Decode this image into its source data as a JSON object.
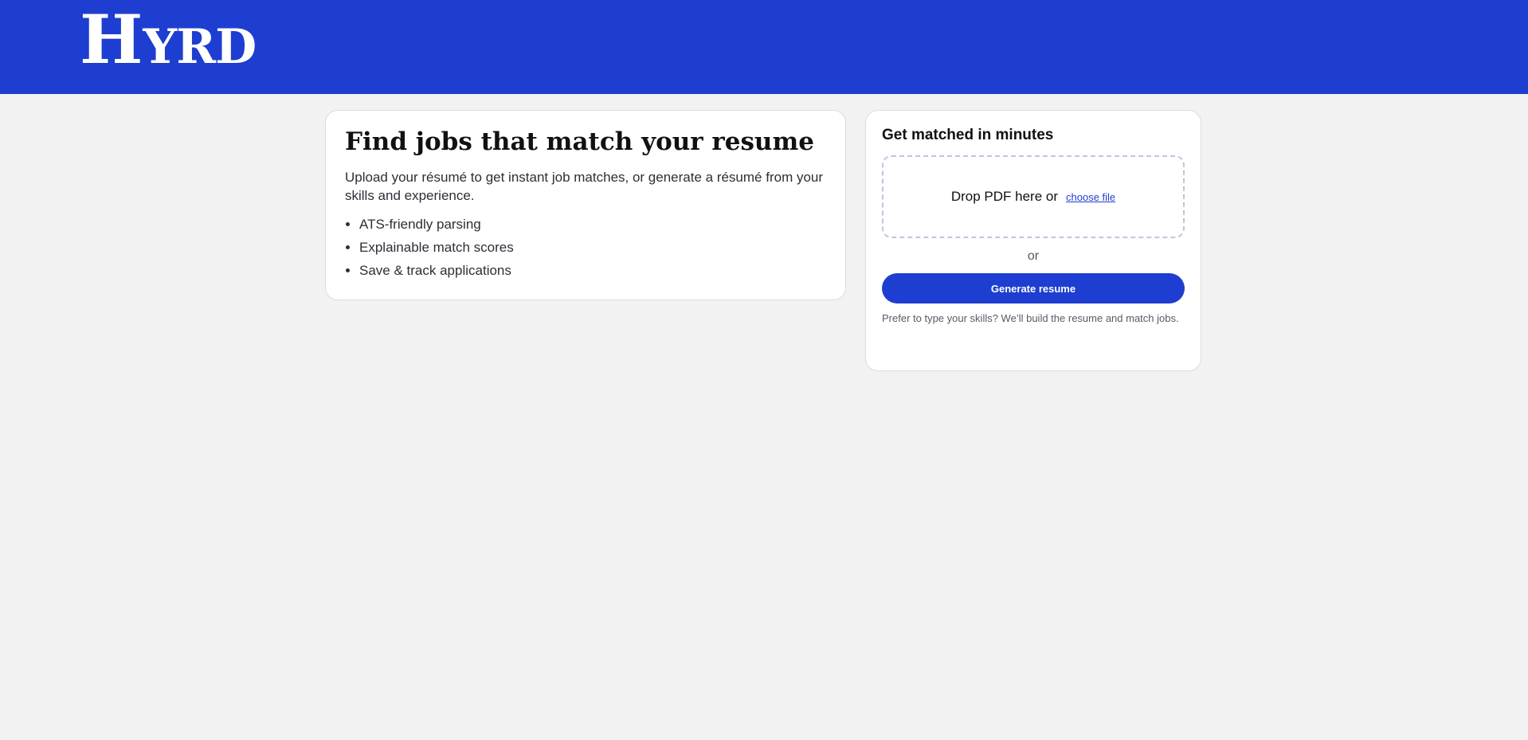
{
  "brand": {
    "logo_initial": "H",
    "logo_rest": "YRD",
    "header_color": "#1e3ed1"
  },
  "hero": {
    "title": "Find jobs that match your resume",
    "subtitle": "Upload your résumé to get instant job matches, or generate a résumé from your skills and experience.",
    "features": [
      "ATS-friendly parsing",
      "Explainable match scores",
      "Save & track applications"
    ]
  },
  "matcher": {
    "title": "Get matched in minutes",
    "drop_text": "Drop PDF here or",
    "choose_file_label": "choose file",
    "or_label": "or",
    "generate_label": "Generate resume",
    "hint": "Prefer to type your skills? We’ll build the resume and match jobs."
  }
}
